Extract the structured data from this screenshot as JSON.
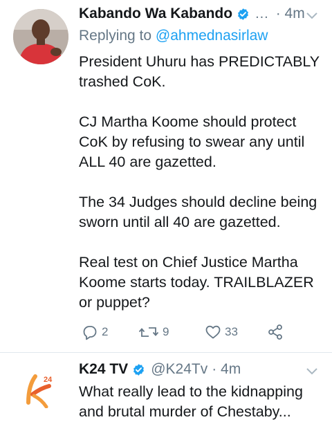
{
  "tweet1": {
    "author_name": "Kabando Wa Kabando",
    "ellipsis": "...",
    "time": "· 4m",
    "reply_prefix": "Replying to ",
    "reply_handle": "@ahmednasirlaw",
    "paragraphs": [
      [
        "President Uhuru has PREDICTABLY",
        "trashed CoK."
      ],
      [
        "CJ Martha Koome should protect",
        "CoK by refusing to swear any until",
        "ALL 40 are gazetted."
      ],
      [
        "The 34 Judges should decline being",
        "sworn until all 40 are gazetted."
      ],
      [
        "Real test on Chief Justice Martha",
        "Koome starts today. TRAILBLAZER",
        "or puppet?"
      ]
    ],
    "actions": {
      "reply_count": "2",
      "retweet_count": "9",
      "like_count": "33"
    }
  },
  "tweet2": {
    "author_name": "K24 TV",
    "handle": "@K24Tv",
    "time": "· 4m",
    "line1": "What really lead to the kidnapping",
    "line2": "and brutal murder of Chestaby..."
  },
  "colors": {
    "accent": "#1da1f2",
    "muted": "#657786",
    "text": "#14171a",
    "like": "#657786"
  },
  "icons": [
    "verified-badge-icon",
    "chevron-down-icon",
    "reply-icon",
    "retweet-icon",
    "like-icon",
    "share-icon"
  ]
}
